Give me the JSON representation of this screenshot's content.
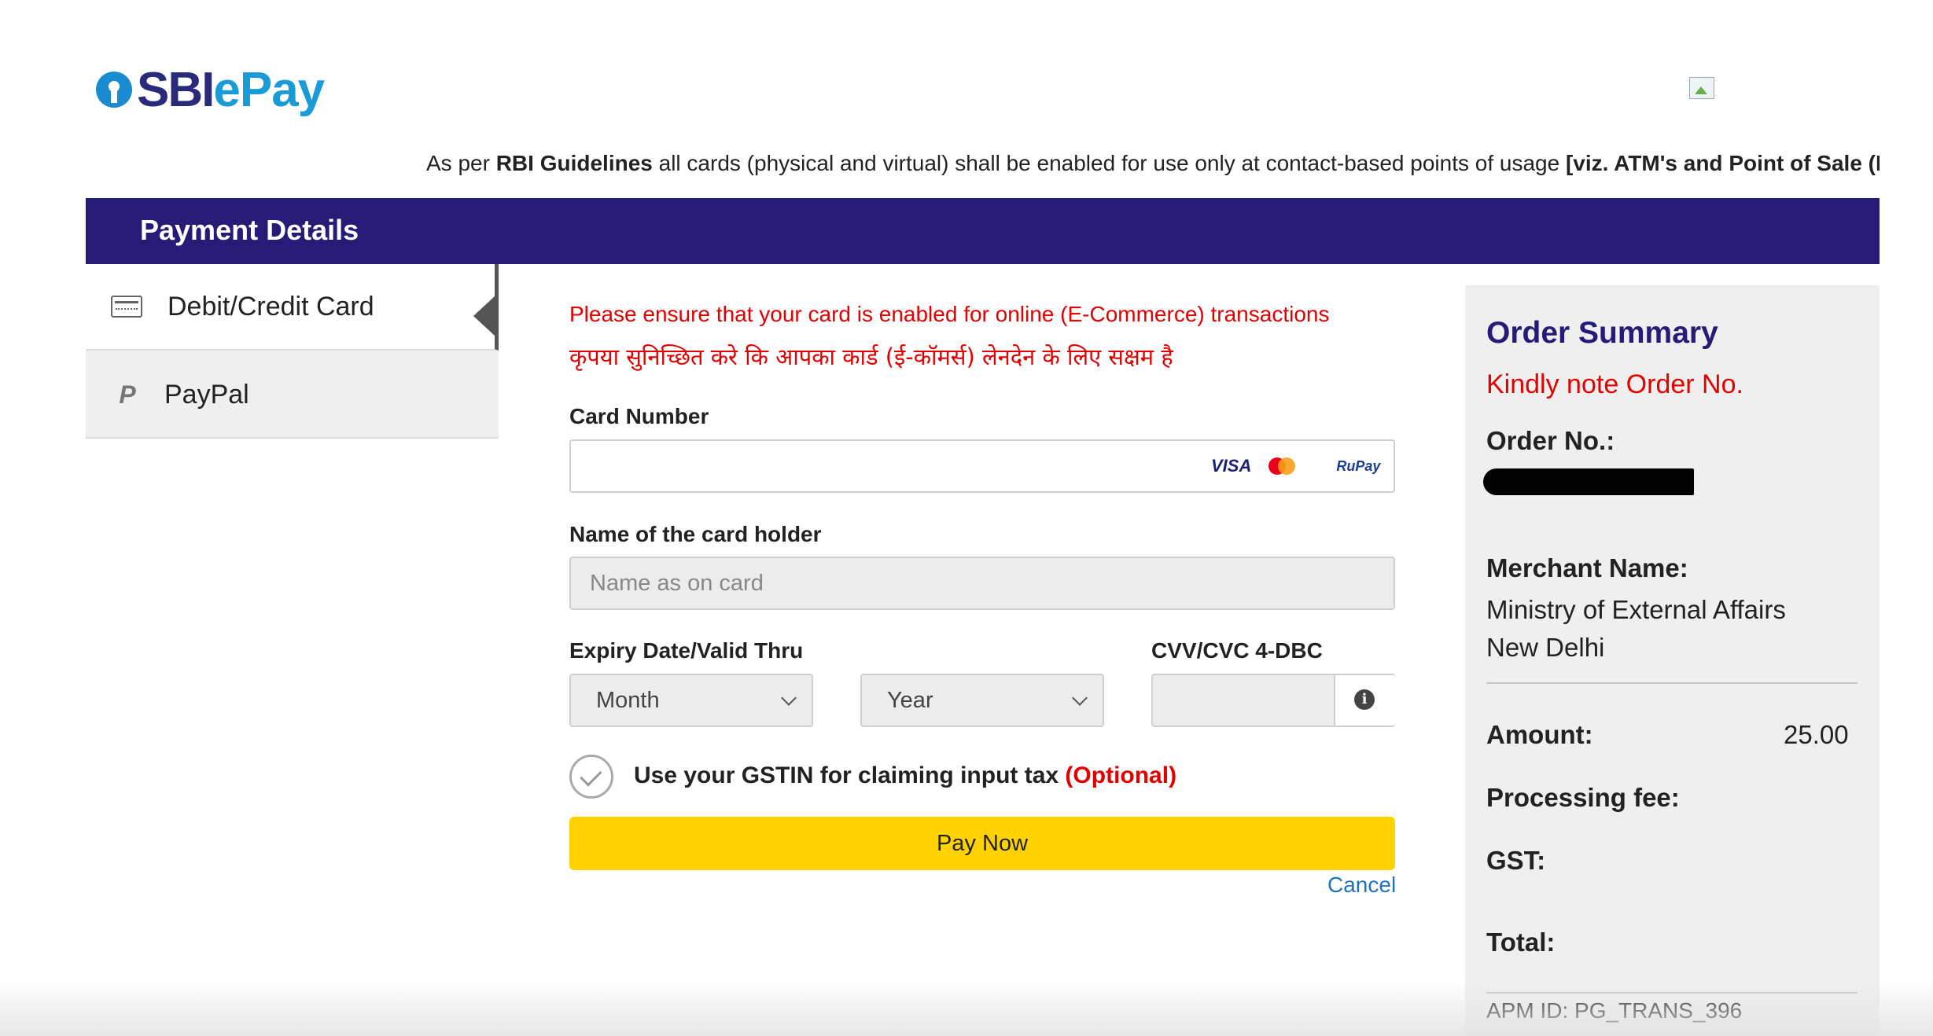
{
  "brand": {
    "sbi": "SBI",
    "epay": "ePay"
  },
  "notice": {
    "prefix": "As per ",
    "rbi": "RBI Guidelines",
    "middle": " all cards (physical and virtual) shall be enabled for use only at contact-based points of usage ",
    "bold_tail": "[viz. ATM's and Point of Sale (PO"
  },
  "header": {
    "title": "Payment Details"
  },
  "nav": {
    "items": [
      {
        "label": "Debit/Credit Card",
        "icon": "card-icon",
        "selected": true
      },
      {
        "label": "PayPal",
        "icon": "paypal-icon",
        "selected": false
      }
    ]
  },
  "form": {
    "message_en": "Please ensure that your card is enabled for online (E-Commerce) transactions",
    "message_hi": "कृपया सुनिच्छित करे कि आपका कार्ड (ई-कॉमर्स) लेनदेन के लिए सक्षम है",
    "card_number_label": "Card Number",
    "card_number_value": "",
    "card_brands": {
      "visa": "VISA",
      "rupay": "RuPay"
    },
    "name_label": "Name of the card holder",
    "name_placeholder": "Name as on card",
    "expiry_label": "Expiry Date/Valid Thru",
    "month_selected": "Month",
    "year_selected": "Year",
    "cvv_label": "CVV/CVC 4-DBC",
    "cvv_value": "",
    "info_glyph": "i",
    "gst_text": "Use your GSTIN for claiming input tax ",
    "gst_optional": "(Optional)",
    "pay_button": "Pay Now",
    "cancel": "Cancel"
  },
  "summary": {
    "title": "Order Summary",
    "note": "Kindly note Order No.",
    "order_no_label": "Order No.:",
    "merchant_label": "Merchant Name:",
    "merchant_line1": "Ministry of External Affairs",
    "merchant_line2": "New Delhi",
    "amount_label": "Amount:",
    "amount_value": "25.00",
    "processing_fee_label": "Processing fee:",
    "gst_label": "GST:",
    "total_label": "Total:",
    "apm_id": "APM ID: PG_TRANS_396"
  },
  "colors": {
    "header_bg": "#261b76",
    "error_red": "#e30000",
    "pay_button": "#ffd200",
    "link_blue": "#1e73be",
    "brand_blue": "#1a9ad6"
  }
}
